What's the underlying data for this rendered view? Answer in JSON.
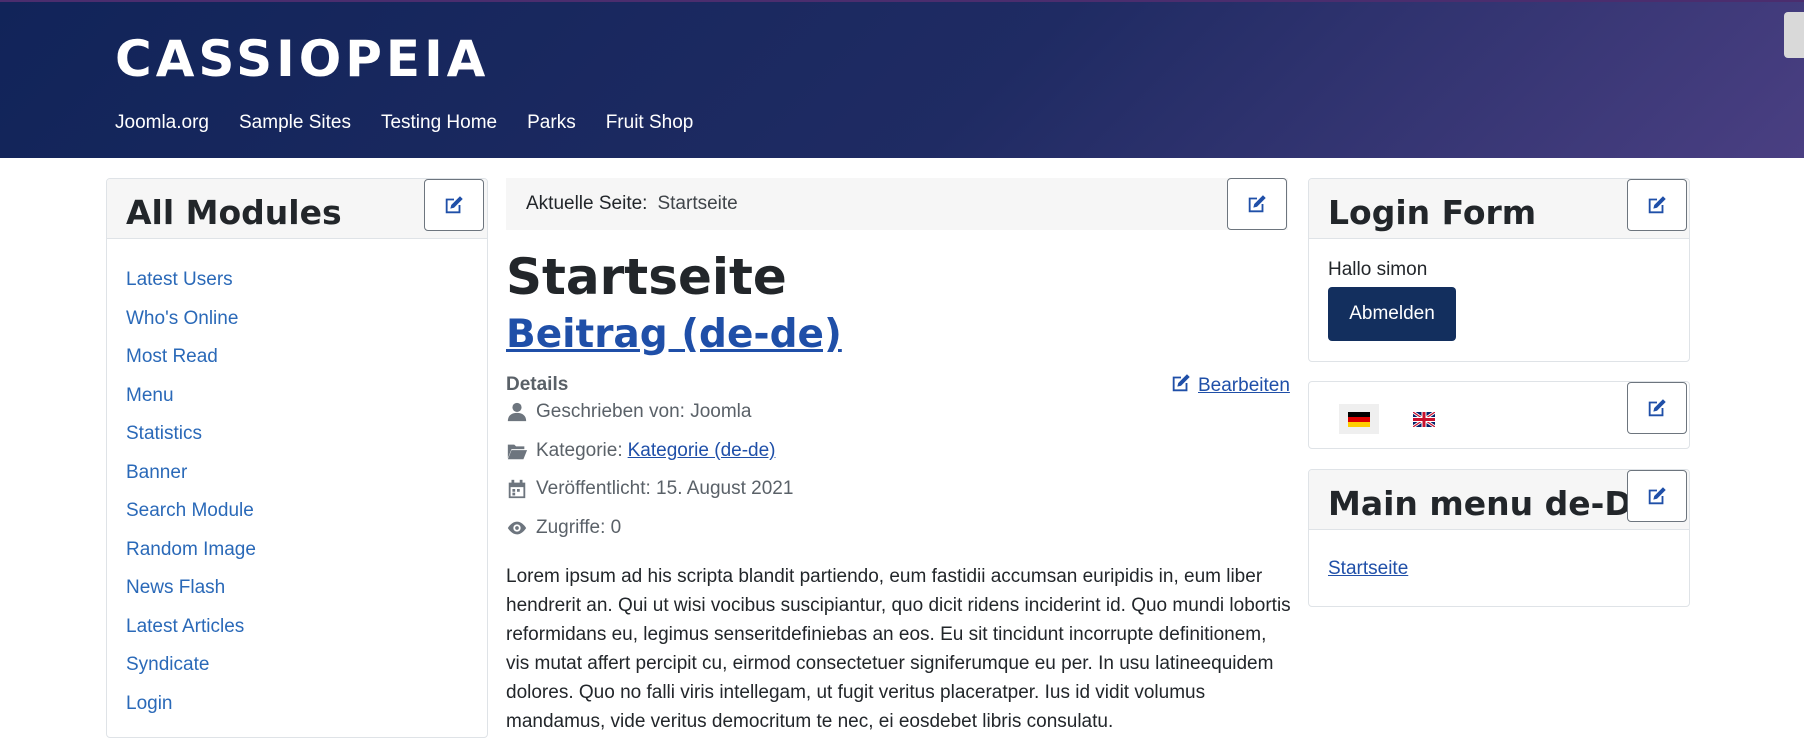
{
  "header": {
    "brand": "CASSIOPEIA",
    "nav": [
      "Joomla.org",
      "Sample Sites",
      "Testing Home",
      "Parks",
      "Fruit Shop"
    ]
  },
  "left_module": {
    "title": "All Modules",
    "links": [
      "Latest Users",
      "Who's Online",
      "Most Read",
      "Menu",
      "Statistics",
      "Banner",
      "Search Module",
      "Random Image",
      "News Flash",
      "Latest Articles",
      "Syndicate",
      "Login"
    ]
  },
  "breadcrumb": {
    "label": "Aktuelle Seite:",
    "current": "Startseite"
  },
  "article": {
    "page_title": "Startseite",
    "title": "Beitrag (de-de)",
    "details_label": "Details",
    "edit_label": "Bearbeiten",
    "author": "Geschrieben von: Joomla",
    "category_label": "Kategorie:",
    "category_link": "Kategorie (de-de)",
    "published": "Veröffentlicht: 15. August 2021",
    "hits": "Zugriffe: 0",
    "body": "Lorem ipsum ad his scripta blandit partiendo, eum fastidii accumsan euripidis in, eum liber hendrerit an. Qui ut wisi vocibus suscipiantur, quo dicit ridens inciderint id. Quo mundi lobortis reformidans eu, legimus senseritdefiniebas an eos. Eu sit tincidunt incorrupte definitionem, vis mutat affert percipit cu, eirmod consectetuer signiferumque eu per. In usu latineequidem dolores. Quo no falli viris intellegam, ut fugit veritus placeratper. Ius id vidit volumus mandamus, vide veritus democritum te nec, ei eosdebet libris consulatu."
  },
  "login_module": {
    "title": "Login Form",
    "greeting": "Hallo simon",
    "logout_label": "Abmelden"
  },
  "language_module": {
    "languages": [
      "de-DE",
      "en-GB"
    ]
  },
  "main_menu_module": {
    "title": "Main menu de-DE",
    "link": "Startseite"
  },
  "colors": {
    "header_start": "#112459",
    "header_end": "#4a3f82",
    "link": "#2a69b8",
    "button": "#132f5e"
  }
}
